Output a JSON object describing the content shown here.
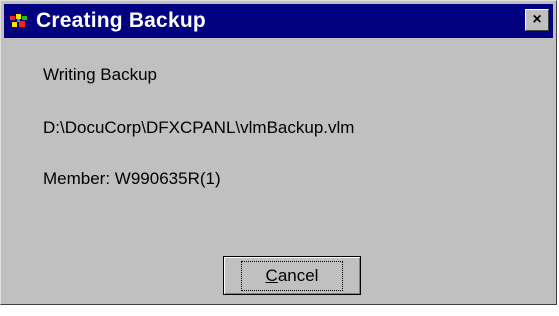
{
  "window": {
    "title": "Creating Backup",
    "close_glyph": "×"
  },
  "body": {
    "status": "Writing Backup",
    "path": "D:\\DocuCorp\\DFXCPANL\\vlmBackup.vlm",
    "member": "Member: W990635R(1)"
  },
  "buttons": {
    "cancel_first": "C",
    "cancel_rest": "ancel"
  },
  "icons": {
    "app": "app-logo-icon"
  },
  "colors": {
    "titlebar": "#000080",
    "dialog_bg": "#c0c0c0"
  }
}
